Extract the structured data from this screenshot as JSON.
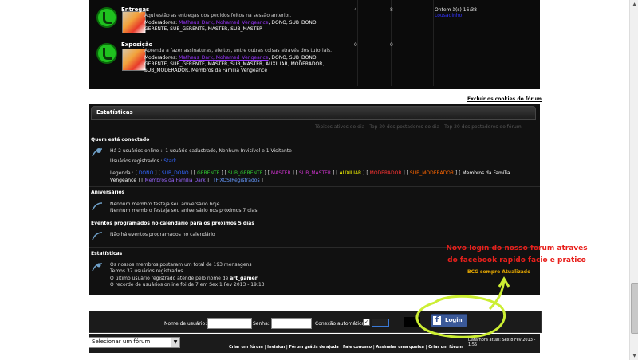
{
  "forums": [
    {
      "title": "Entregas",
      "description": "Aqui estão as entregas dos pedidos feitos na sessão anterior.",
      "moderators_label": "Moderadores:",
      "moderators_highlight": "Matheus_Dark, Mohamed_Vengeance",
      "moderators_rest_1": ", DONO, SUB_DONO,",
      "moderators_rest_2": "GERENTE, SUB_GERENTE, MASTER, SUB_MASTER",
      "topics": "4",
      "posts": "8",
      "last_post": "Ontem à(s) 16:38",
      "last_post_user": "Lousadinho"
    },
    {
      "title": "Exposição",
      "description": "Aprenda a fazer assinaturas, efeitos, entre outras coisas através dos tutoriais.",
      "moderators_label": "Moderadores:",
      "moderators_highlight": "Matheus_Dark, Mohamed_Vengeance",
      "moderators_rest_1": ", DONO, SUB_DONO,",
      "moderators_rest_2": "GERENTE, SUB_GERENTE, MASTER, SUB_MASTER, AUXILIAR, MODERADOR,",
      "moderators_rest_3": "SUB_MODERADOR, Membros da Família Vengeance",
      "topics": "0",
      "posts": "0"
    }
  ],
  "cookies_link": "Excluir os cookies do fórum",
  "stats": {
    "header": "Estatísticas",
    "tab_active_topics": "Tópicos ativos do dia",
    "tab_top_day": "Top 20 dos postadores do dia",
    "tab_top_month": "Top 20 dos postadores do fórum",
    "sep": "-",
    "online": {
      "title": "Quem está conectado",
      "line1": "Há 2 usuários online :: 1 usuário cadastrado, Nenhum Invisível e 1 Visitante",
      "registered_label": "Usuários registrados :",
      "registered_user": "Stark",
      "legend_label": "Legenda :",
      "legend_items": [
        {
          "label": "DONO",
          "color": "#3366ff"
        },
        {
          "label": "SUB_DONO",
          "color": "#3366ff"
        },
        {
          "label": "GERENTE",
          "color": "#33cc33"
        },
        {
          "label": "SUB_GERENTE",
          "color": "#33cc33"
        },
        {
          "label": "MASTER",
          "color": "#cc33cc"
        },
        {
          "label": "SUB_MASTER",
          "color": "#cc33cc"
        },
        {
          "label": "AUXILIAR",
          "color": "#ffff00"
        },
        {
          "label": "MODERADOR",
          "color": "#ff3333"
        },
        {
          "label": "SUB_MODERADOR",
          "color": "#ff6600"
        },
        {
          "label": "Membros da Família Vengeance",
          "color": "#ffffff"
        },
        {
          "label": "Membros da Família Dark",
          "color": "#9966ff"
        },
        {
          "label": "[FIXOS]Registrados",
          "color": "#6699ff"
        }
      ]
    },
    "birthdays": {
      "title": "Aniversários",
      "line1": "Nenhum membro festeja seu aniversário hoje",
      "line2": "Nenhum membro festeja seu aniversário nos próximos 7 dias"
    },
    "events": {
      "title": "Eventos programados no calendário para os próximos 5 dias",
      "line1": "Não há eventos programados no calendário"
    },
    "statistics": {
      "title": "Estatísticas",
      "line1": "Os nossos membros postaram um total de 193 mensagens",
      "line2": "Temos 37 usuários registrados",
      "line3_prefix": "O último usuário registrado atende pelo nome de",
      "line3_user": "art_gamer",
      "line4": "O recorde de usuários online foi de 7 em Sex 1 Fev 2013 - 19:13"
    }
  },
  "annotation": {
    "line1": "Novo login do nosso forum atraves",
    "line2": "do facebook rapido facio e pratico",
    "sub": "BCG sempre Atualizado",
    "color": "#e8201c",
    "circle_color": "#ccee33"
  },
  "login": {
    "username_label": "Nome de usuário:",
    "password_label": "Senha:",
    "auto_label": "Conexão automática:",
    "auto_checked": "✓",
    "fb_icon": "f",
    "fb_label": "Login"
  },
  "footer": {
    "select_value": "Selecionar um fórum",
    "select_arrow": "▼",
    "datetime": "Data/hora atual: Sex 8 Fev 2013 - 1:55",
    "links": "Criar um fórum | Invision | Fórum grátis de ajuda | Fale conosco | Assinalar uma queixa | Criar um fórum"
  },
  "scroll": {
    "up": "▲",
    "down": "▼"
  }
}
